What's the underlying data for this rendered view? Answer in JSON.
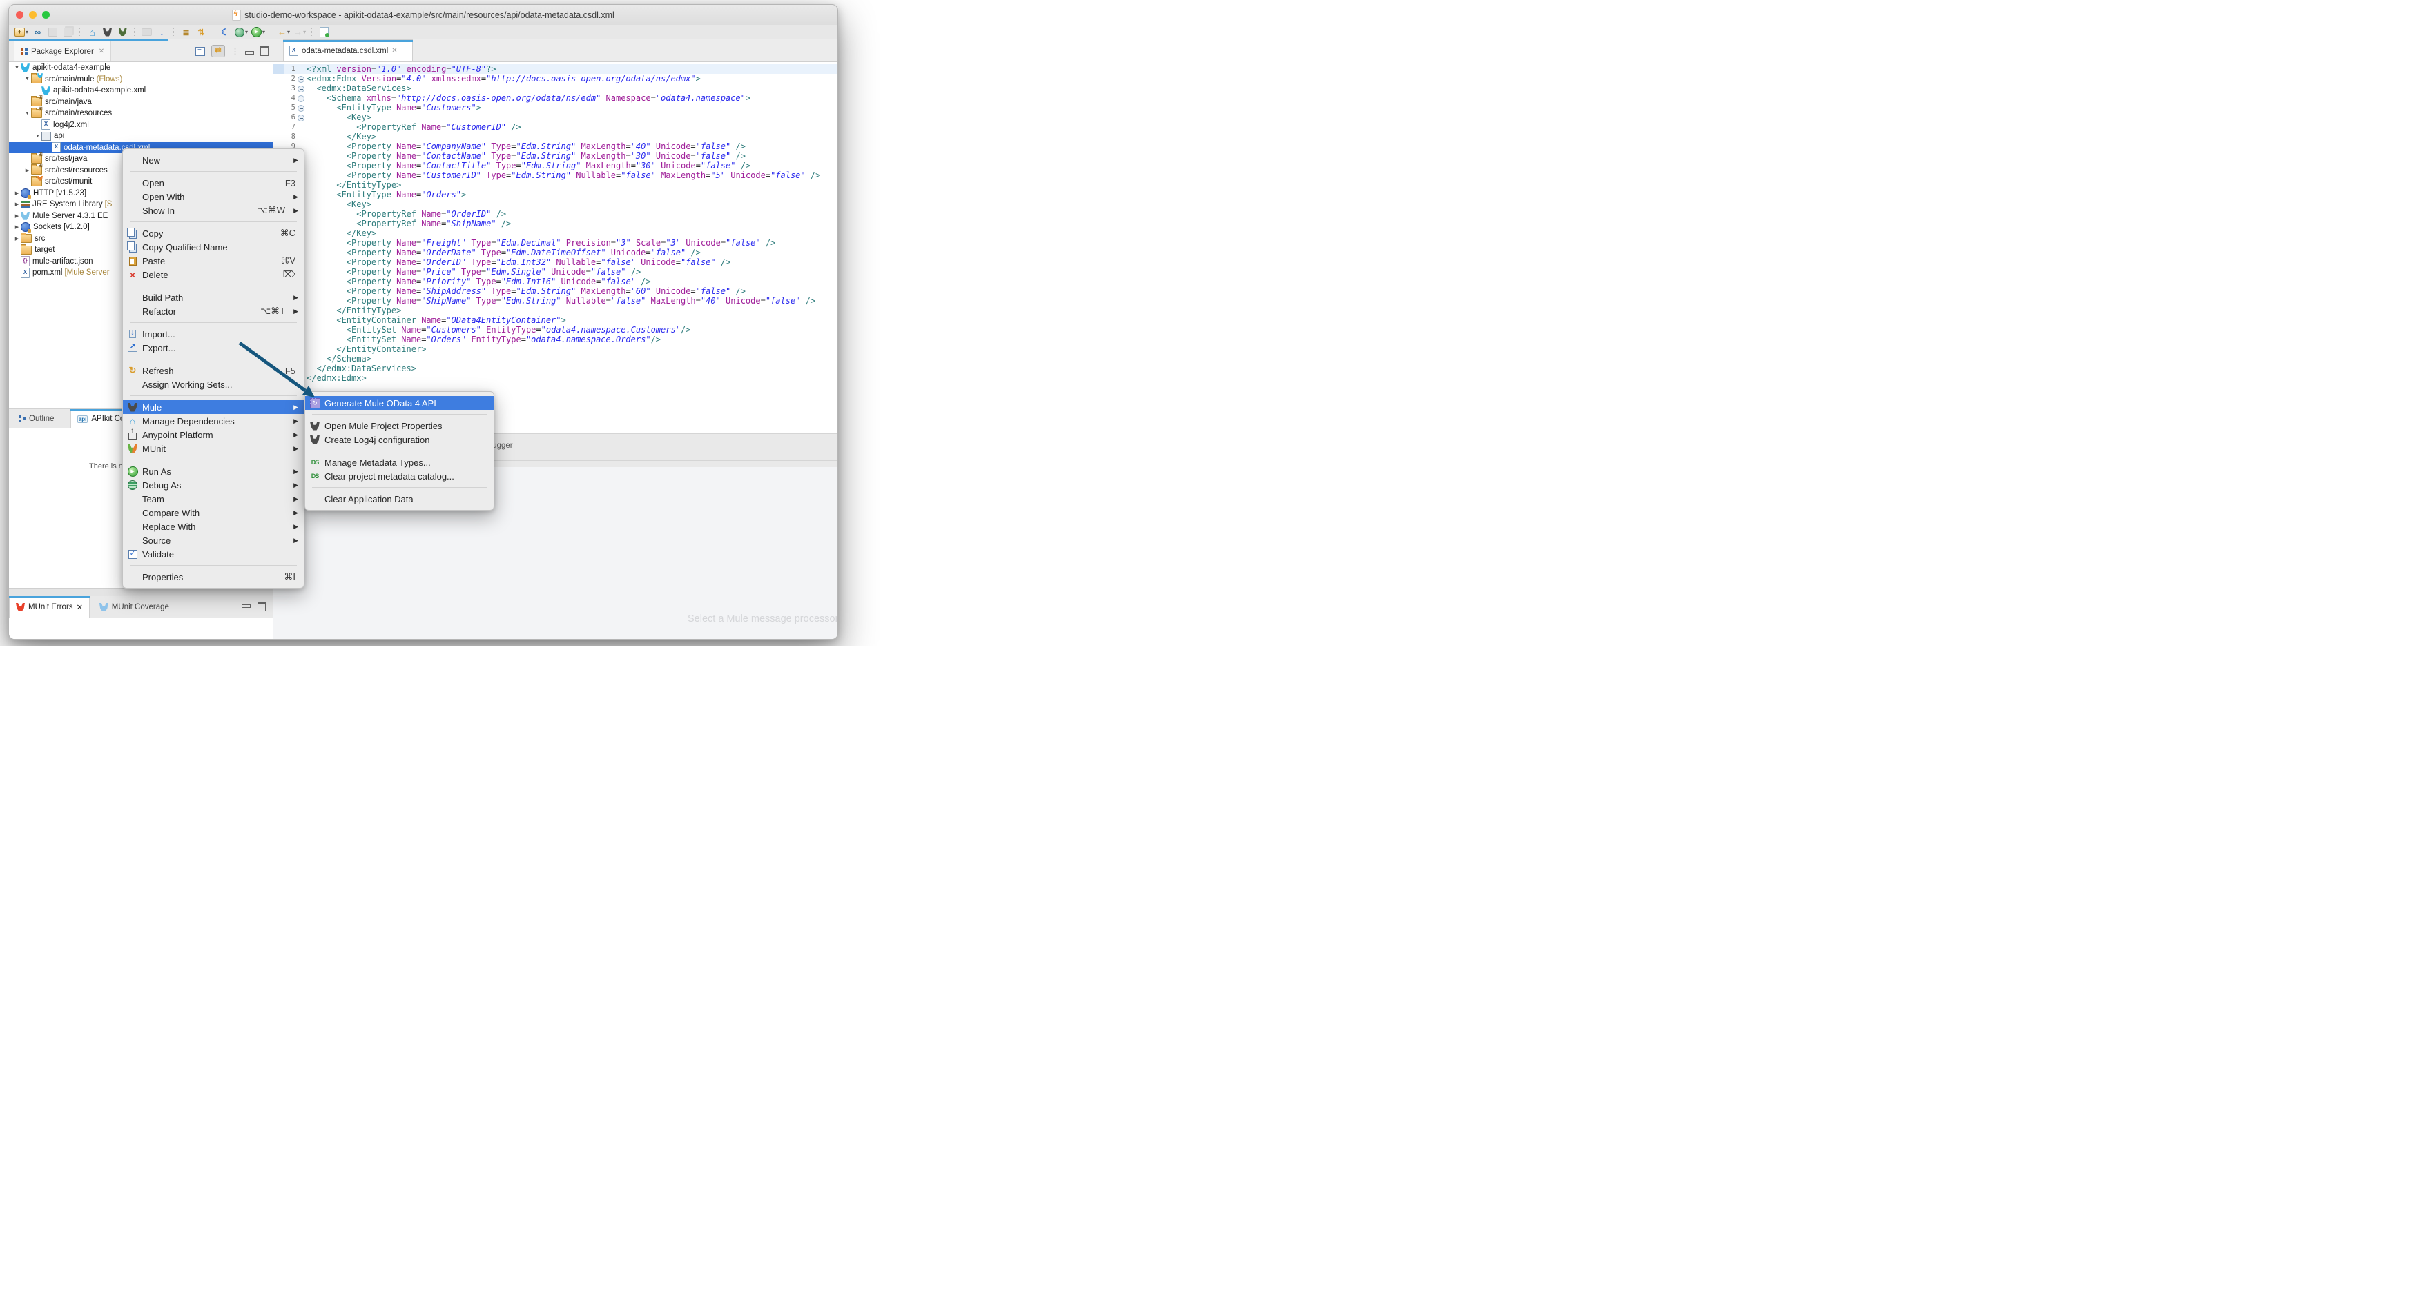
{
  "window": {
    "title": "studio-demo-workspace - apikit-odata4-example/src/main/resources/api/odata-metadata.csdl.xml"
  },
  "toolbar": {
    "buttons": [
      {
        "name": "new-wizard",
        "dropdown": true
      },
      {
        "name": "sync"
      },
      {
        "name": "save",
        "disabled": true
      },
      {
        "name": "save-all",
        "disabled": true
      },
      {
        "name": "separator"
      },
      {
        "name": "anypoint-home"
      },
      {
        "name": "mule"
      },
      {
        "name": "deploy"
      },
      {
        "name": "separator"
      },
      {
        "name": "runtime",
        "disabled": true
      },
      {
        "name": "import-launch"
      },
      {
        "name": "separator"
      },
      {
        "name": "config-scroll"
      },
      {
        "name": "transform-file"
      },
      {
        "name": "separator"
      },
      {
        "name": "night-mode"
      },
      {
        "name": "debug",
        "dropdown": true
      },
      {
        "name": "run",
        "dropdown": true
      },
      {
        "name": "separator"
      },
      {
        "name": "back",
        "dropdown": true
      },
      {
        "name": "forward",
        "dropdown": true,
        "disabled": true
      },
      {
        "name": "separator"
      },
      {
        "name": "new-flow"
      }
    ]
  },
  "package_explorer": {
    "tab": "Package Explorer",
    "toolbar_icons": [
      "collapse-all",
      "link-with-editor",
      "view-menu",
      "minimize",
      "maximize"
    ],
    "tree": [
      {
        "depth": 0,
        "arrow": "expanded",
        "icon": "mule-project",
        "label": "apikit-odata4-example"
      },
      {
        "depth": 1,
        "arrow": "expanded",
        "icon": "mule-folder",
        "label": "src/main/mule",
        "suffix": " (Flows)"
      },
      {
        "depth": 2,
        "icon": "mule-file",
        "label": "apikit-odata4-example.xml"
      },
      {
        "depth": 1,
        "icon": "package-folder",
        "label": "src/main/java"
      },
      {
        "depth": 1,
        "arrow": "expanded",
        "icon": "package-folder",
        "label": "src/main/resources"
      },
      {
        "depth": 2,
        "icon": "xml-file",
        "label": "log4j2.xml"
      },
      {
        "depth": 2,
        "arrow": "expanded",
        "icon": "api-folder",
        "label": "api"
      },
      {
        "depth": 3,
        "icon": "xml-file",
        "label": "odata-metadata.csdl.xml",
        "selected": true
      },
      {
        "depth": 1,
        "icon": "package-folder",
        "label": "src/test/java"
      },
      {
        "depth": 1,
        "arrow": "collapsed",
        "icon": "package-folder",
        "label": "src/test/resources"
      },
      {
        "depth": 1,
        "icon": "munit-folder",
        "label": "src/test/munit"
      },
      {
        "depth": 0,
        "arrow": "collapsed",
        "icon": "http-connector",
        "label": "HTTP [v1.5.23]"
      },
      {
        "depth": 0,
        "arrow": "collapsed",
        "icon": "library",
        "label": "JRE System Library",
        "suffix": " [S"
      },
      {
        "depth": 0,
        "arrow": "collapsed",
        "icon": "mule-server",
        "label": "Mule Server 4.3.1 EE"
      },
      {
        "depth": 0,
        "arrow": "collapsed",
        "icon": "socket-connector",
        "label": "Sockets [v1.2.0]"
      },
      {
        "depth": 0,
        "arrow": "collapsed",
        "icon": "folder",
        "label": "src"
      },
      {
        "depth": 0,
        "icon": "folder",
        "label": "target"
      },
      {
        "depth": 0,
        "icon": "json-file",
        "label": "mule-artifact.json"
      },
      {
        "depth": 0,
        "icon": "xml-file",
        "label": "pom.xml",
        "suffix": " [Mule Server"
      }
    ]
  },
  "editor": {
    "tab": "odata-metadata.csdl.xml",
    "lines": [
      {
        "n": 1,
        "text": "<?xml version=\"1.0\" encoding=\"UTF-8\"?>",
        "current": true
      },
      {
        "n": 2,
        "fold": true,
        "text": "<edmx:Edmx Version=\"4.0\" xmlns:edmx=\"http://docs.oasis-open.org/odata/ns/edmx\">"
      },
      {
        "n": 3,
        "fold": true,
        "text": "  <edmx:DataServices>"
      },
      {
        "n": 4,
        "fold": true,
        "text": "    <Schema xmlns=\"http://docs.oasis-open.org/odata/ns/edm\" Namespace=\"odata4.namespace\">"
      },
      {
        "n": 5,
        "fold": true,
        "text": "      <EntityType Name=\"Customers\">"
      },
      {
        "n": 6,
        "fold": true,
        "text": "        <Key>"
      },
      {
        "n": 7,
        "text": "          <PropertyRef Name=\"CustomerID\" />"
      },
      {
        "n": 8,
        "text": "        </Key>"
      },
      {
        "n": 9,
        "text": "        <Property Name=\"CompanyName\" Type=\"Edm.String\" MaxLength=\"40\" Unicode=\"false\" />"
      },
      {
        "n": 10,
        "text": "        <Property Name=\"ContactName\" Type=\"Edm.String\" MaxLength=\"30\" Unicode=\"false\" />"
      },
      {
        "n": 11,
        "text": "        <Property Name=\"ContactTitle\" Type=\"Edm.String\" MaxLength=\"30\" Unicode=\"false\" />"
      },
      {
        "n": 12,
        "text": "        <Property Name=\"CustomerID\" Type=\"Edm.String\" Nullable=\"false\" MaxLength=\"5\" Unicode=\"false\" />"
      },
      {
        "n": 13,
        "text": "      </EntityType>"
      },
      {
        "n": 14,
        "fold": true,
        "text": "      <EntityType Name=\"Orders\">"
      },
      {
        "n": 15,
        "fold": true,
        "text": "        <Key>"
      },
      {
        "n": 16,
        "text": "          <PropertyRef Name=\"OrderID\" />"
      },
      {
        "n": 17,
        "text": "          <PropertyRef Name=\"ShipName\" />"
      },
      {
        "n": 18,
        "text": "        </Key>"
      },
      {
        "n": 19,
        "text": "        <Property Name=\"Freight\" Type=\"Edm.Decimal\" Precision=\"3\" Scale=\"3\" Unicode=\"false\" />"
      },
      {
        "n": 20,
        "text": "        <Property Name=\"OrderDate\" Type=\"Edm.DateTimeOffset\" Unicode=\"false\" />"
      },
      {
        "n": 21,
        "text": "        <Property Name=\"OrderID\" Type=\"Edm.Int32\" Nullable=\"false\" Unicode=\"false\" />"
      },
      {
        "n": 22,
        "text": "        <Property Name=\"Price\" Type=\"Edm.Single\" Unicode=\"false\" />"
      },
      {
        "n": 23,
        "text": "        <Property Name=\"Priority\" Type=\"Edm.Int16\" Unicode=\"false\" />"
      },
      {
        "n": 24,
        "text": "        <Property Name=\"ShipAddress\" Type=\"Edm.String\" MaxLength=\"60\" Unicode=\"false\" />"
      },
      {
        "n": 25,
        "text": "        <Property Name=\"ShipName\" Type=\"Edm.String\" Nullable=\"false\" MaxLength=\"40\" Unicode=\"false\" />"
      },
      {
        "n": 26,
        "text": "      </EntityType>"
      },
      {
        "n": 27,
        "fold": true,
        "text": "      <EntityContainer Name=\"OData4EntityContainer\">"
      },
      {
        "n": 28,
        "text": "        <EntitySet Name=\"Customers\" EntityType=\"odata4.namespace.Customers\"/>"
      },
      {
        "n": 29,
        "text": "        <EntitySet Name=\"Orders\" EntityType=\"odata4.namespace.Orders\"/>"
      },
      {
        "n": 30,
        "text": "      </EntityContainer>"
      },
      {
        "n": 31,
        "text": "    </Schema>"
      },
      {
        "n": 32,
        "text": "  </edmx:DataServices>"
      },
      {
        "n": 33,
        "text": "</edmx:Edmx>"
      }
    ]
  },
  "context_menu": {
    "sections": [
      [
        {
          "label": "New",
          "submenu": true
        }
      ],
      [
        {
          "label": "Open",
          "shortcut": "F3"
        },
        {
          "label": "Open With",
          "submenu": true
        },
        {
          "label": "Show In",
          "shortcut": "⌥⌘W",
          "submenu": true
        }
      ],
      [
        {
          "label": "Copy",
          "icon": "copy",
          "shortcut": "⌘C"
        },
        {
          "label": "Copy Qualified Name",
          "icon": "copy-qualified"
        },
        {
          "label": "Paste",
          "icon": "paste",
          "shortcut": "⌘V"
        },
        {
          "label": "Delete",
          "icon": "delete",
          "shortcut": "⌦"
        }
      ],
      [
        {
          "label": "Build Path",
          "submenu": true
        },
        {
          "label": "Refactor",
          "shortcut": "⌥⌘T",
          "submenu": true
        }
      ],
      [
        {
          "label": "Import...",
          "icon": "import"
        },
        {
          "label": "Export...",
          "icon": "export"
        }
      ],
      [
        {
          "label": "Refresh",
          "icon": "refresh",
          "shortcut": "F5"
        },
        {
          "label": "Assign Working Sets..."
        }
      ],
      [
        {
          "label": "Mule",
          "icon": "mule-dark",
          "submenu": true,
          "highlighted": true
        },
        {
          "label": "Manage Dependencies",
          "icon": "manage-dependencies",
          "submenu": true
        },
        {
          "label": "Anypoint Platform",
          "icon": "anypoint-platform",
          "submenu": true
        },
        {
          "label": "MUnit",
          "icon": "munit",
          "submenu": true
        }
      ],
      [
        {
          "label": "Run As",
          "icon": "run",
          "submenu": true
        },
        {
          "label": "Debug As",
          "icon": "debug",
          "submenu": true
        },
        {
          "label": "Team",
          "submenu": true
        },
        {
          "label": "Compare With",
          "submenu": true
        },
        {
          "label": "Replace With",
          "submenu": true
        },
        {
          "label": "Source",
          "submenu": true
        },
        {
          "label": "Validate",
          "icon": "validate"
        }
      ],
      [
        {
          "label": "Properties",
          "shortcut": "⌘I"
        }
      ]
    ]
  },
  "mule_submenu": {
    "sections": [
      [
        {
          "label": "Generate Mule OData 4 API",
          "icon": "generate-odata",
          "highlighted": true
        }
      ],
      [
        {
          "label": "Open Mule Project Properties",
          "icon": "mule-dark"
        },
        {
          "label": "Create Log4j configuration",
          "icon": "mule-dark"
        }
      ],
      [
        {
          "label": "Manage Metadata Types...",
          "icon": "metadata"
        },
        {
          "label": "Clear project metadata catalog...",
          "icon": "metadata"
        }
      ],
      [
        {
          "label": "Clear Application Data"
        }
      ]
    ]
  },
  "apikit_panel": {
    "tabs": [
      {
        "label": "Outline",
        "icon": "outline"
      },
      {
        "label": "APIkit Console",
        "icon": "api",
        "active": true
      }
    ],
    "message": "There is n"
  },
  "munit_panel": {
    "tabs": [
      {
        "label": "MUnit Errors",
        "icon": "mule-red",
        "active": true,
        "closable": true
      },
      {
        "label": "MUnit Coverage",
        "icon": "mule-lightblue"
      }
    ]
  },
  "debugger_panel": {
    "tab": "Mule Debugger",
    "placeholder": "Select a Mule message processor to"
  },
  "colors": {
    "accent_blue": "#49a3dc",
    "selection_blue": "#3070d8",
    "menu_highlight": "#3e7de0",
    "xml_tag": "#2e7c7c",
    "xml_attr": "#a0209a",
    "xml_value": "#2a2aee"
  }
}
